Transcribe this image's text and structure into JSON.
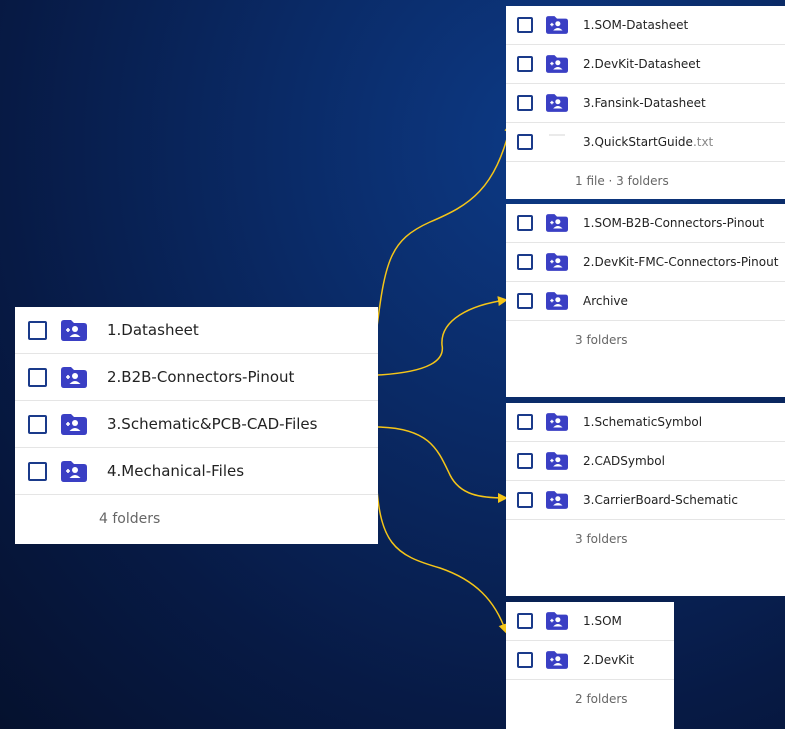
{
  "main_panel": {
    "items": [
      {
        "label": "1.Datasheet",
        "icon": "shared-folder-icon"
      },
      {
        "label": "2.B2B-Connectors-Pinout",
        "icon": "shared-folder-icon"
      },
      {
        "label": "3.Schematic&PCB-CAD-Files",
        "icon": "shared-folder-icon"
      },
      {
        "label": "4.Mechanical-Files",
        "icon": "shared-folder-icon"
      }
    ],
    "footer": "4 folders"
  },
  "datasheet_panel": {
    "items": [
      {
        "label": "1.SOM-Datasheet",
        "icon": "shared-folder-icon"
      },
      {
        "label": "2.DevKit-Datasheet",
        "icon": "shared-folder-icon"
      },
      {
        "label": "3.Fansink-Datasheet",
        "icon": "shared-folder-icon"
      }
    ],
    "file": {
      "name": "3.QuickStartGuide",
      "ext": ".txt",
      "icon": "text-file-icon"
    },
    "footer": "1 file · 3 folders"
  },
  "pinout_panel": {
    "items": [
      {
        "label": "1.SOM-B2B-Connectors-Pinout",
        "icon": "shared-folder-icon"
      },
      {
        "label": "2.DevKit-FMC-Connectors-Pinout",
        "icon": "shared-folder-icon"
      },
      {
        "label": "Archive",
        "icon": "shared-folder-icon"
      }
    ],
    "footer": "3 folders"
  },
  "cad_panel": {
    "items": [
      {
        "label": "1.SchematicSymbol",
        "icon": "shared-folder-icon"
      },
      {
        "label": "2.CADSymbol",
        "icon": "shared-folder-icon"
      },
      {
        "label": "3.CarrierBoard-Schematic",
        "icon": "shared-folder-icon"
      }
    ],
    "footer": "3 folders"
  },
  "mechanical_panel": {
    "items": [
      {
        "label": "1.SOM",
        "icon": "shared-folder-icon"
      },
      {
        "label": "2.DevKit",
        "icon": "shared-folder-icon"
      }
    ],
    "footer": "2 folders"
  },
  "colors": {
    "background": "#0a2a66",
    "folder_icon": "#3a3fc4",
    "checkbox_border": "#1a3a8a",
    "connector_arrow": "#f5c518"
  }
}
